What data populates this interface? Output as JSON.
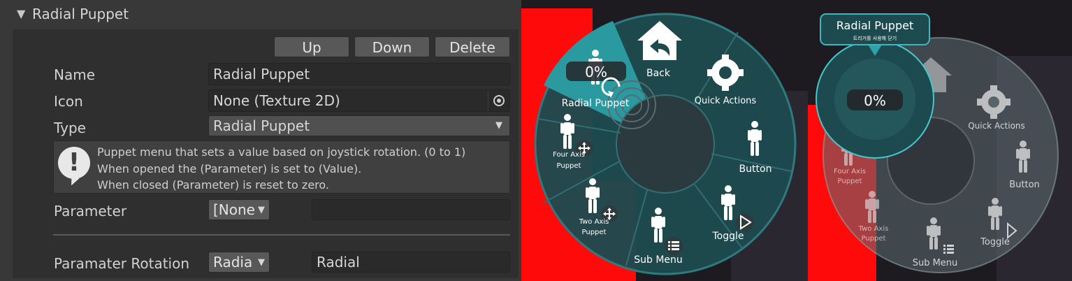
{
  "section": {
    "title": "Radial Puppet"
  },
  "toolbar": {
    "up_label": "Up",
    "down_label": "Down",
    "delete_label": "Delete"
  },
  "fields": {
    "name_label": "Name",
    "name_value": "Radial Puppet",
    "icon_label": "Icon",
    "icon_value": "None (Texture 2D)",
    "type_label": "Type",
    "type_value": "Radial Puppet",
    "parameter_label": "Parameter",
    "parameter_value": "[None",
    "rotation_label": "Paramater Rotation",
    "rotation_value": "Radia",
    "rotation_text": "Radial"
  },
  "help": {
    "line1": "Puppet menu that sets a value based on joystick rotation. (0 to 1)",
    "line2": "When opened the (Parameter) is set to (Value).",
    "line3": "When closed (Parameter) is reset to zero."
  },
  "menu": {
    "back": "Back",
    "quick_actions": "Quick Actions",
    "button": "Button",
    "toggle": "Toggle",
    "sub_menu": "Sub Menu",
    "two_axis_1": "Two Axis",
    "two_axis_2": "Puppet",
    "four_axis_1": "Four Axis",
    "four_axis_2": "Puppet",
    "radial_puppet": "Radial Puppet",
    "percent": "0%"
  },
  "popup": {
    "title": "Radial Puppet",
    "subtitle": "트리거를 사용해 닫기",
    "percent": "0%"
  },
  "colors": {
    "menu_teal": "#1d4a4e",
    "highlight": "#2a9aa0",
    "red_block": "#ff0a0a"
  }
}
